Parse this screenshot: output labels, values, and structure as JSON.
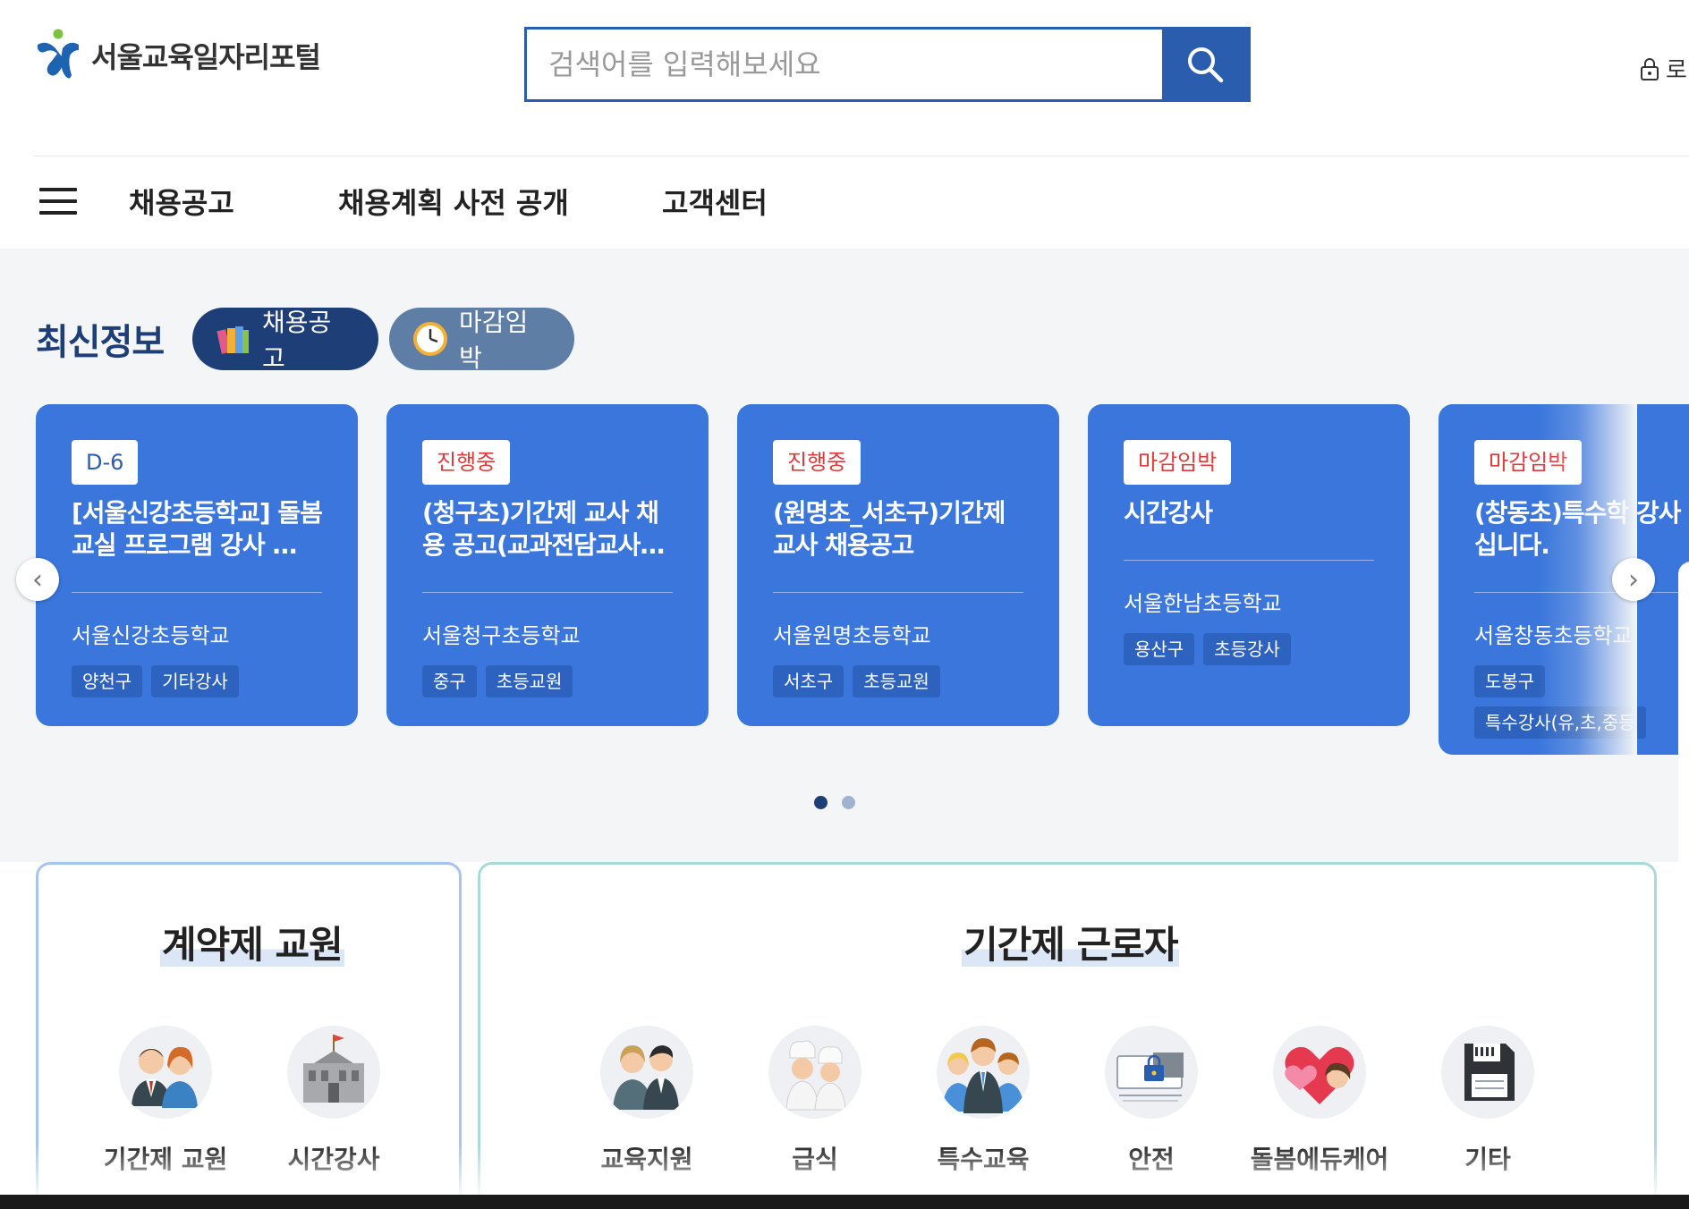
{
  "header": {
    "logo_text": "서울교육일자리포털",
    "search_placeholder": "검색어를 입력해보세요",
    "login_label": "로"
  },
  "nav": {
    "items": [
      {
        "label": "채용공고"
      },
      {
        "label": "채용계획 사전 공개"
      },
      {
        "label": "고객센터"
      }
    ]
  },
  "latest": {
    "title": "최신정보",
    "tabs": [
      {
        "label": "채용공고",
        "icon": "books-icon",
        "active": true
      },
      {
        "label": "마감임박",
        "icon": "clock-icon",
        "active": false
      }
    ],
    "cards": [
      {
        "badge": "D-6",
        "title": "[서울신강초등학교] 돌봄교실 프로그램 강사 …",
        "school": "서울신강초등학교",
        "tags": [
          "양천구",
          "기타강사"
        ]
      },
      {
        "badge": "진행중",
        "title": "(청구초)기간제 교사 채용 공고(교과전담교사…",
        "school": "서울청구초등학교",
        "tags": [
          "중구",
          "초등교원"
        ]
      },
      {
        "badge": "진행중",
        "title": "(원명초_서초구)기간제 교사 채용공고",
        "school": "서울원명초등학교",
        "tags": [
          "서초구",
          "초등교원"
        ]
      },
      {
        "badge": "마감임박",
        "title": "시간강사",
        "school": "서울한남초등학교",
        "tags": [
          "용산구",
          "초등강사"
        ]
      },
      {
        "badge": "마감임박",
        "title": "(창동초)특수학 강사 모십니다.",
        "school": "서울창동초등학교",
        "tags": [
          "도봉구",
          "특수강사(유,초,중등"
        ]
      }
    ],
    "carousel": {
      "prev": "‹",
      "next": "›",
      "pages": 2,
      "current": 1
    }
  },
  "categories": {
    "contract": {
      "title": "계약제 교원",
      "items": [
        {
          "label": "기간제 교원",
          "icon": "teachers-icon"
        },
        {
          "label": "시간강사",
          "icon": "school-building-icon"
        }
      ]
    },
    "fixed_term": {
      "title": "기간제 근로자",
      "items": [
        {
          "label": "교육지원",
          "icon": "staff-icon"
        },
        {
          "label": "급식",
          "icon": "chefs-icon"
        },
        {
          "label": "특수교육",
          "icon": "group-icon"
        },
        {
          "label": "안전",
          "icon": "security-monitor-icon"
        },
        {
          "label": "돌봄에듀케어",
          "icon": "heart-care-icon"
        },
        {
          "label": "기타",
          "icon": "floppy-disk-icon"
        }
      ]
    }
  },
  "colors": {
    "primary": "#2b5dae",
    "navy": "#1e3e78",
    "card": "#3a76dc",
    "badge_red": "#e03b3b"
  }
}
